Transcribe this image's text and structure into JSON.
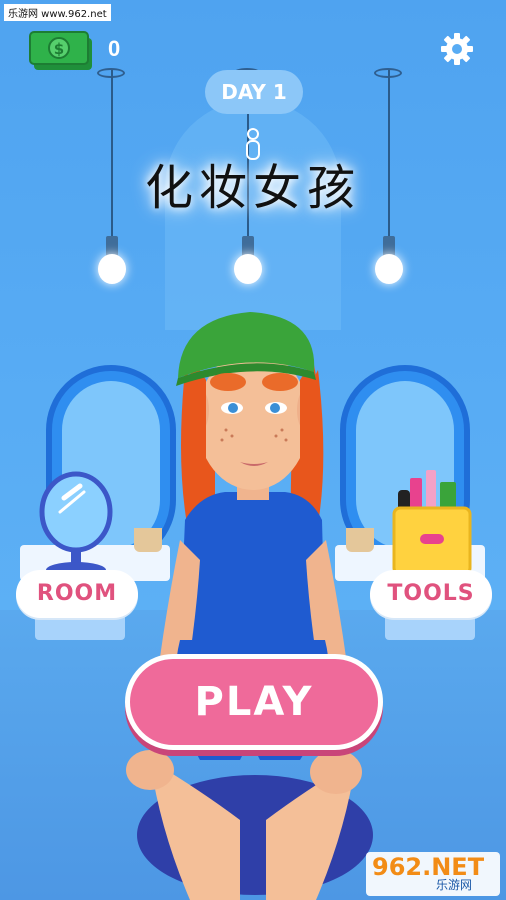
{
  "watermark": "乐游网 www.962.net",
  "hud": {
    "money_count": "0",
    "money_icon": "cash-icon",
    "settings_icon": "gear-icon"
  },
  "day_label": "DAY 1",
  "game_title": "化妆女孩",
  "buttons": {
    "room": "ROOM",
    "tools": "TOOLS",
    "play": "PLAY"
  },
  "logo": {
    "main": "962.NET",
    "sub": "乐游网"
  },
  "colors": {
    "background": "#58acf4",
    "play_button": "#ef6a9a",
    "button_text": "#e0527e",
    "money_green": "#2fb24a"
  }
}
